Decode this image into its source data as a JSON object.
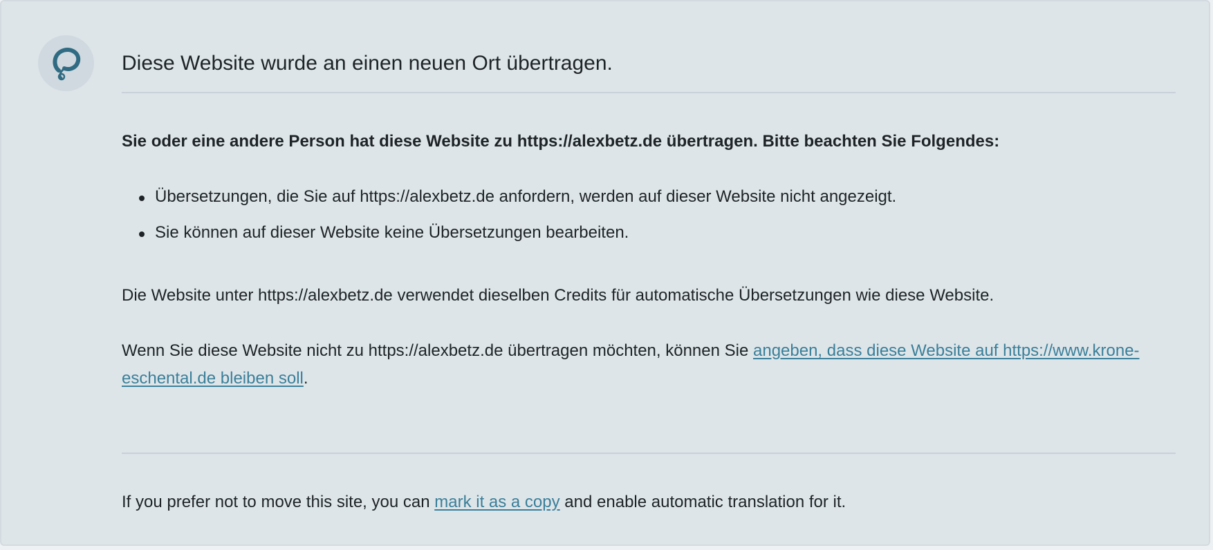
{
  "notice": {
    "logo_icon": "translation-plugin-logo-icon",
    "title": "Diese Website wurde an einen neuen Ort übertragen.",
    "intro": "Sie oder eine andere Person hat diese Website zu https://alexbetz.de übertragen. Bitte beachten Sie Folgendes:",
    "bullets": [
      "Übersetzungen, die Sie auf https://alexbetz.de anfordern, werden auf dieser Website nicht angezeigt.",
      "Sie können auf dieser Website keine Übersetzungen bearbeiten."
    ],
    "credits_text": "Die Website unter https://alexbetz.de verwendet dieselben Credits für automatische Übersetzungen wie diese Website.",
    "stay_text_before": "Wenn Sie diese Website nicht zu https://alexbetz.de übertragen möchten, können Sie ",
    "stay_link": "angeben, dass diese Website auf https://www.krone-eschental.de bleiben soll",
    "stay_text_after": ".",
    "copy_text_before": "If you prefer not to move this site, you can ",
    "copy_link": "mark it as a copy",
    "copy_text_after": " and enable automatic translation for it."
  },
  "colors": {
    "background": "#dee5e9",
    "link": "#3a7f99",
    "logo": "#2f6b82",
    "text": "#1d2327"
  }
}
